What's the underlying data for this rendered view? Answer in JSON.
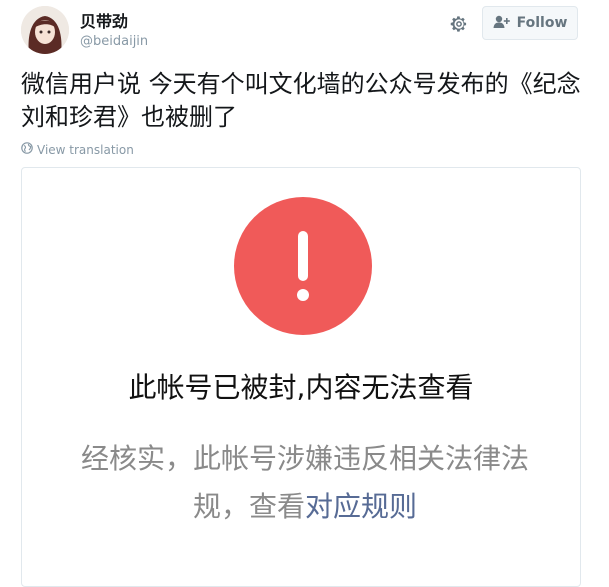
{
  "header": {
    "display_name": "贝带劲",
    "handle": "@beidaijin",
    "gear_icon": "gear-icon",
    "follow_label": "Follow",
    "follow_icon": "add-user-icon"
  },
  "tweet": {
    "text": "微信用户说 今天有个叫文化墙的公众号发布的《纪念刘和珍君》也被删了",
    "translation_label": "View translation",
    "translation_icon": "globe-icon"
  },
  "card": {
    "alert_icon": "exclamation-icon",
    "alert_color": "#f05a59",
    "heading": "此帐号已被封,内容无法查看",
    "body_text": "经核实，此帐号涉嫌违反相关法律法规，查看",
    "rules_link": "对应规则",
    "link_color": "#576b95"
  }
}
